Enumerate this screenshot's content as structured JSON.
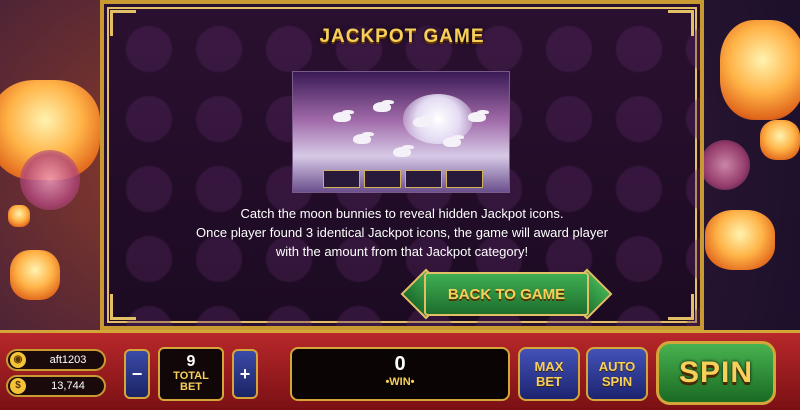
{
  "dialog": {
    "title": "JACKPOT GAME",
    "description_lines": [
      "Catch the moon bunnies to reveal hidden Jackpot icons.",
      "Once player found 3 identical Jackpot icons, the game will award player",
      "with the amount from that Jackpot category!"
    ],
    "back_button_label": "BACK TO GAME"
  },
  "player": {
    "username": "aft1203",
    "balance": "13,744"
  },
  "controls": {
    "minus_label": "−",
    "plus_label": "+",
    "total_bet_value": "9",
    "total_bet_label_1": "TOTAL",
    "total_bet_label_2": "BET",
    "win_value": "0",
    "win_label": "•WIN•",
    "max_bet_line1": "MAX",
    "max_bet_line2": "BET",
    "auto_spin_line1": "AUTO",
    "auto_spin_line2": "SPIN",
    "spin_label": "SPIN"
  },
  "icons": {
    "user": "user-icon",
    "coin": "coin-icon"
  },
  "colors": {
    "gold": "#f6d05a",
    "green_button": "#2f8f3f",
    "blue_button": "#3b4aa6",
    "red_bar": "#b8282a"
  }
}
